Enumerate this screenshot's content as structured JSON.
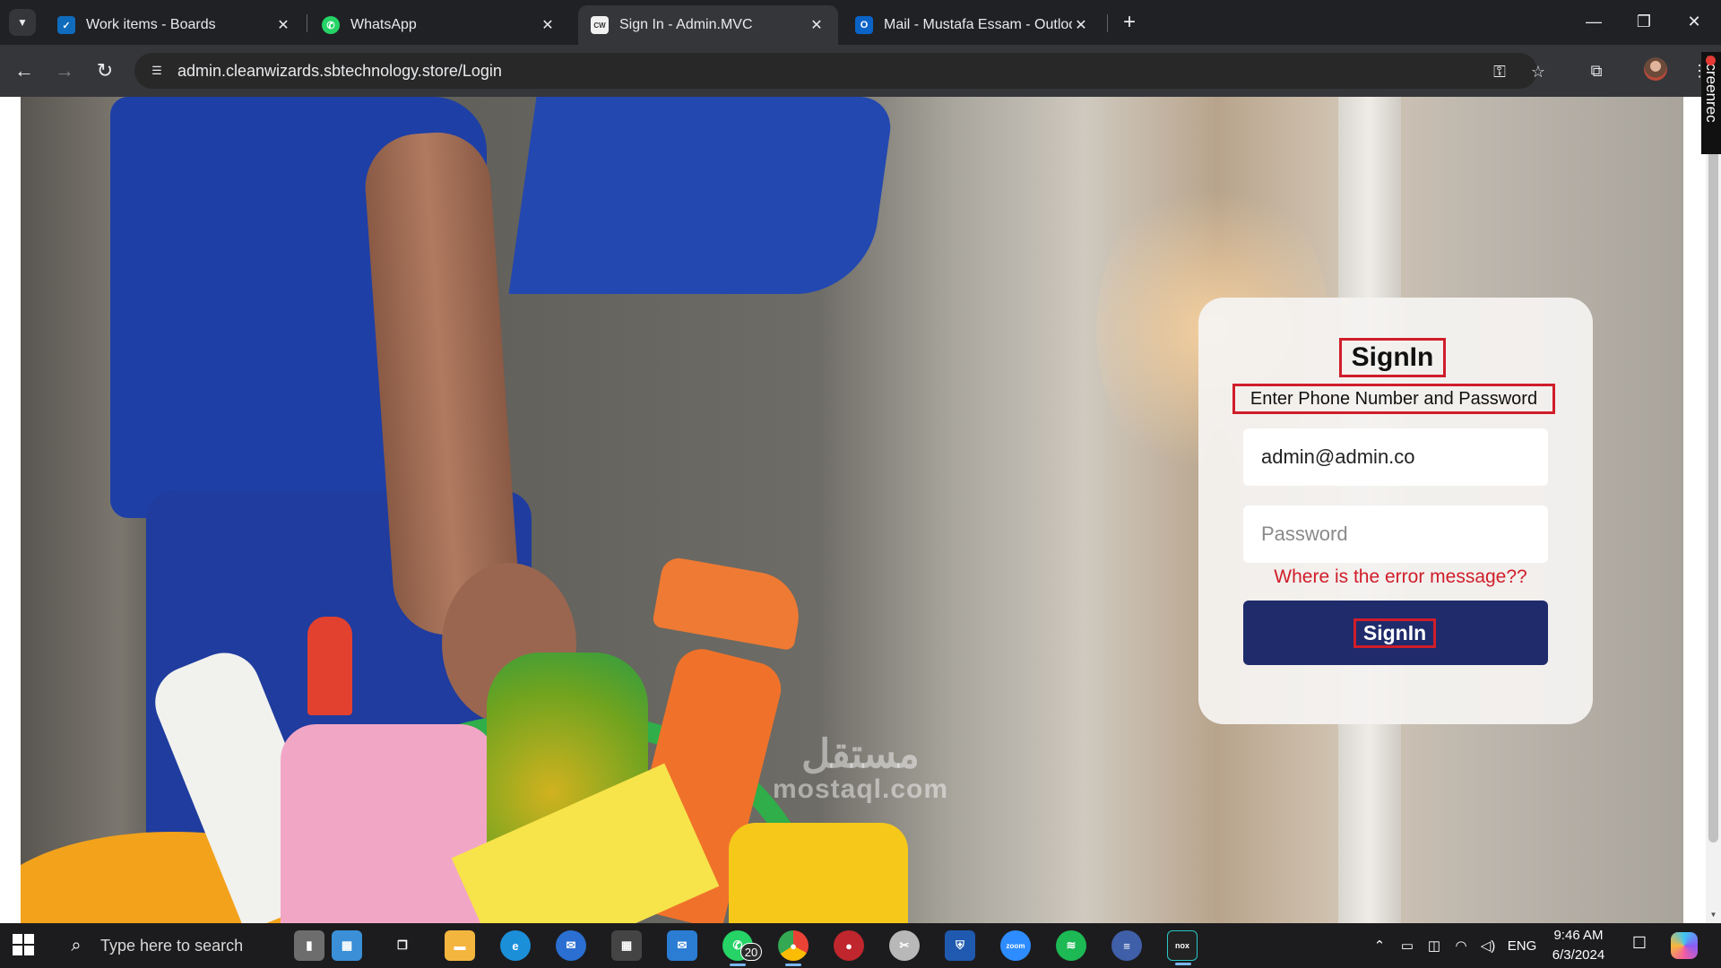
{
  "browser": {
    "tabs": [
      {
        "title": "Work items - Boards",
        "icon": "azure-boards-icon",
        "active": false
      },
      {
        "title": "WhatsApp",
        "icon": "whatsapp-icon",
        "active": false
      },
      {
        "title": "Sign In - Admin.MVC",
        "icon": "clean-wizards-icon",
        "active": true
      },
      {
        "title": "Mail - Mustafa Essam - Outlook",
        "icon": "outlook-icon",
        "active": false
      }
    ],
    "close_glyph": "✕",
    "new_tab_glyph": "+",
    "url": "admin.cleanwizards.sbtechnology.store/Login",
    "recorder_label": "screenrec"
  },
  "login": {
    "title": "SignIn",
    "subtitle": "Enter Phone Number and Password",
    "email_value": "admin@admin.co",
    "password_placeholder": "Password",
    "error_message": "Where is the error message??",
    "submit_label": "SignIn"
  },
  "watermark": {
    "arabic": "مستقل",
    "latin": "mostaql.com"
  },
  "taskbar": {
    "search_placeholder": "Type here to search",
    "whatsapp_badge": "20",
    "language": "ENG",
    "time": "9:46 AM",
    "date": "6/3/2024"
  },
  "colors": {
    "primary_button": "#1f2b6b",
    "annotation_red": "#d01d2a",
    "card_background": "#f4f2f0"
  }
}
